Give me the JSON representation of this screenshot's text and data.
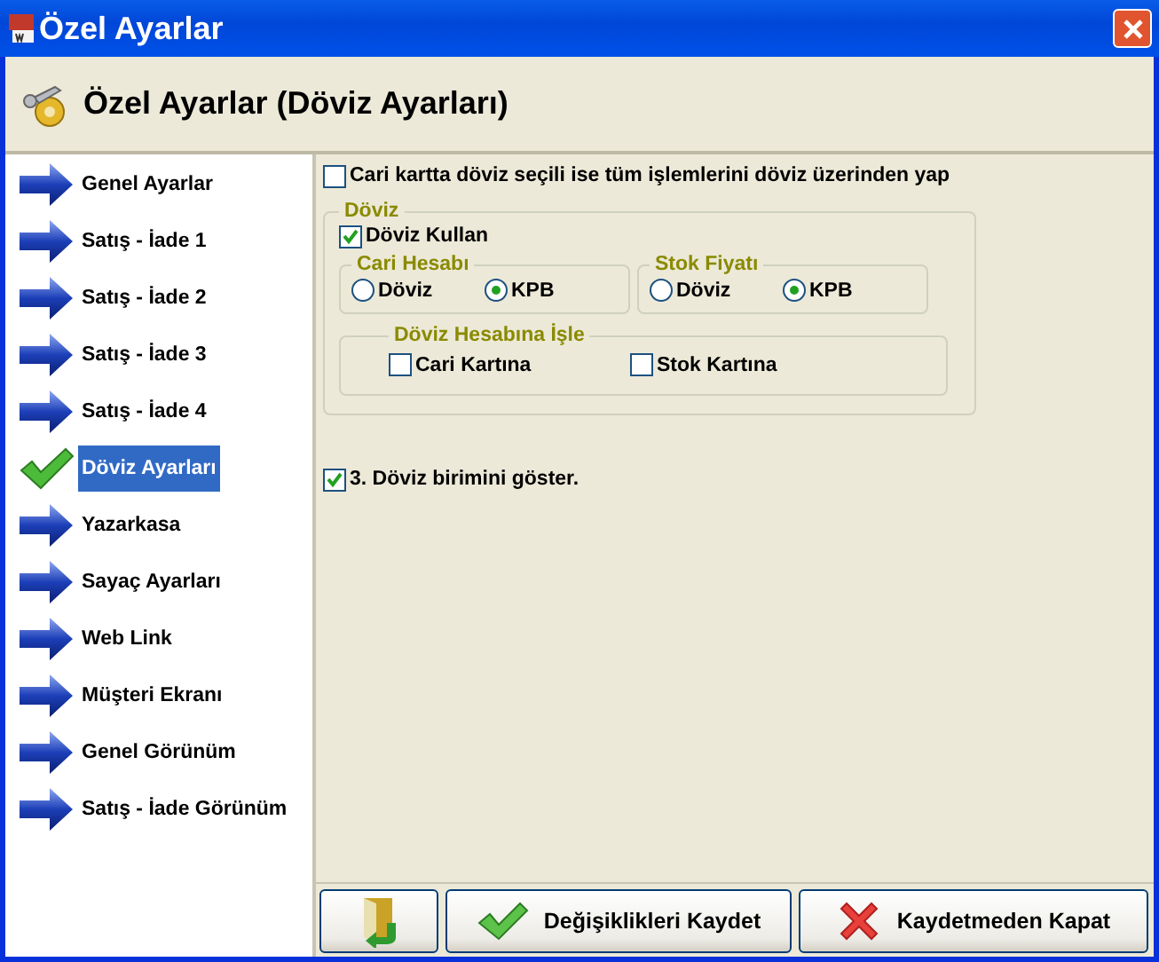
{
  "window": {
    "title": "Özel Ayarlar"
  },
  "header": {
    "title": "Özel Ayarlar (Döviz Ayarları)"
  },
  "sidebar": {
    "items": [
      {
        "label": "Genel Ayarlar",
        "selected": false
      },
      {
        "label": "Satış - İade 1",
        "selected": false
      },
      {
        "label": "Satış - İade 2",
        "selected": false
      },
      {
        "label": "Satış - İade 3",
        "selected": false
      },
      {
        "label": "Satış - İade 4",
        "selected": false
      },
      {
        "label": "Döviz Ayarları",
        "selected": true
      },
      {
        "label": "Yazarkasa",
        "selected": false
      },
      {
        "label": "Sayaç Ayarları",
        "selected": false
      },
      {
        "label": "Web Link",
        "selected": false
      },
      {
        "label": "Müşteri Ekranı",
        "selected": false
      },
      {
        "label": "Genel Görünüm",
        "selected": false
      },
      {
        "label": "Satış - İade Görünüm",
        "selected": false
      }
    ]
  },
  "top_option": {
    "label": "Cari kartta döviz seçili ise tüm işlemlerini döviz üzerinden yap",
    "checked": false
  },
  "doviz_group": {
    "title": "Döviz",
    "use": {
      "label": "Döviz Kullan",
      "checked": true
    },
    "radio_groups": [
      {
        "title": "Cari Hesabı",
        "options": [
          {
            "label": "Döviz",
            "selected": false
          },
          {
            "label": "KPB",
            "selected": true
          }
        ]
      },
      {
        "title": "Stok Fiyatı",
        "options": [
          {
            "label": "Döviz",
            "selected": false
          },
          {
            "label": "KPB",
            "selected": true
          }
        ]
      }
    ],
    "post_group": {
      "title": "Döviz Hesabına İşle",
      "options": [
        {
          "label": "Cari Kartına",
          "checked": false
        },
        {
          "label": "Stok Kartına",
          "checked": false
        }
      ]
    }
  },
  "bottom_option": {
    "label": "3. Döviz birimini göster.",
    "checked": true
  },
  "buttons": [
    {
      "kind": "exit"
    },
    {
      "kind": "save",
      "label": "Değişiklikleri Kaydet"
    },
    {
      "kind": "cancel",
      "label": "Kaydetmeden Kapat"
    }
  ]
}
